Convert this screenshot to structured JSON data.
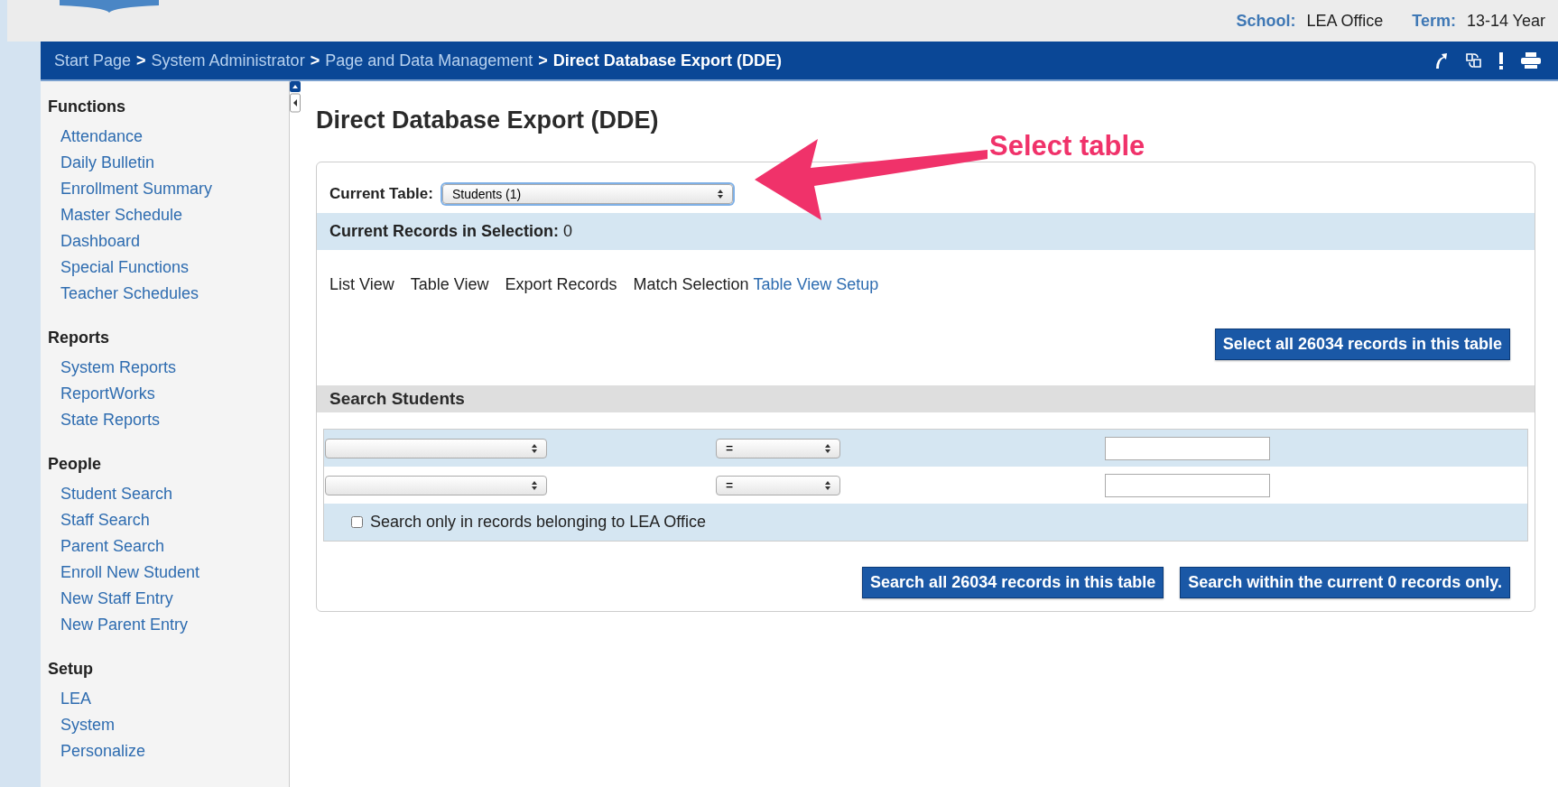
{
  "header": {
    "school_label": "School:",
    "school": "LEA Office",
    "term_label": "Term:",
    "term": "13-14 Year"
  },
  "breadcrumb": {
    "separator": ">",
    "items": [
      {
        "label": "Start Page",
        "current": false
      },
      {
        "label": "System Administrator",
        "current": false
      },
      {
        "label": "Page and Data Management",
        "current": false
      },
      {
        "label": "Direct Database Export (DDE)",
        "current": true
      }
    ]
  },
  "sidebar": {
    "sections": [
      {
        "title": "Functions",
        "items": [
          "Attendance",
          "Daily Bulletin",
          "Enrollment Summary",
          "Master Schedule",
          "Dashboard",
          "Special Functions",
          "Teacher Schedules"
        ]
      },
      {
        "title": "Reports",
        "items": [
          "System Reports",
          "ReportWorks",
          "State Reports"
        ]
      },
      {
        "title": "People",
        "items": [
          "Student Search",
          "Staff Search",
          "Parent Search",
          "Enroll New Student",
          "New Staff Entry",
          "New Parent Entry"
        ]
      },
      {
        "title": "Setup",
        "items": [
          "LEA",
          "System",
          "Personalize"
        ]
      }
    ]
  },
  "page_title": "Direct Database Export (DDE)",
  "current_table": {
    "label": "Current Table:",
    "value": "Students (1)"
  },
  "selection": {
    "label": "Current Records in Selection:",
    "count": "0"
  },
  "views": [
    {
      "label": "List View",
      "kind": "plain"
    },
    {
      "label": "Table View",
      "kind": "plain"
    },
    {
      "label": "Export Records",
      "kind": "plain"
    },
    {
      "label": "Match Selection",
      "kind": "plain"
    },
    {
      "label": "Table View Setup",
      "kind": "link"
    }
  ],
  "select_all_button": "Select all 26034 records in this table",
  "search": {
    "title": "Search Students",
    "criteria": [
      {
        "operator": "="
      },
      {
        "operator": "="
      }
    ],
    "restrict": {
      "label": "Search only in records belonging to LEA Office",
      "checked": false
    },
    "buttons": [
      "Search all 26034 records in this table",
      "Search within the current 0 records only."
    ]
  },
  "annotation": {
    "text": "Select table"
  }
}
